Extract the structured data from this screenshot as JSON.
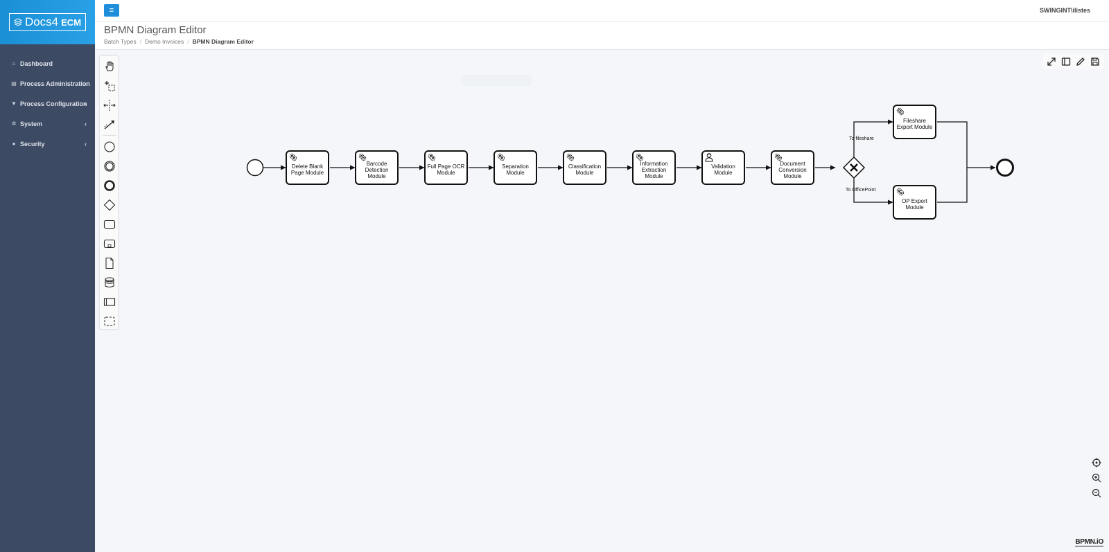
{
  "app": {
    "logo_main": "Docs4",
    "logo_suffix": "ECM"
  },
  "topbar": {
    "menu_icon": "hamburger-icon",
    "user": "SWINGINT\\ilistes"
  },
  "sidebar": {
    "items": [
      {
        "label": "Dashboard",
        "icon": "home-icon",
        "has_submenu": false
      },
      {
        "label": "Process Administration",
        "icon": "document-icon",
        "has_submenu": true
      },
      {
        "label": "Process Configuration",
        "icon": "filter-icon",
        "has_submenu": true
      },
      {
        "label": "System",
        "icon": "gear-icon",
        "has_submenu": true
      },
      {
        "label": "Security",
        "icon": "user-icon",
        "has_submenu": true
      }
    ]
  },
  "page": {
    "title": "BPMN Diagram Editor",
    "breadcrumb": [
      "Batch Types",
      "Demo Invoices",
      "BPMN Diagram Editor"
    ]
  },
  "palette": {
    "tools": [
      "hand-tool-icon",
      "lasso-tool-icon",
      "space-tool-icon",
      "global-connect-icon",
      "start-event-icon",
      "intermediate-event-icon",
      "end-event-icon",
      "gateway-icon",
      "task-icon",
      "subprocess-icon",
      "data-object-icon",
      "data-store-icon",
      "pool-icon",
      "group-icon"
    ]
  },
  "toolbar": {
    "buttons": [
      "fullscreen-icon",
      "properties-panel-icon",
      "edit-icon",
      "save-icon"
    ]
  },
  "zoom": {
    "buttons": [
      "reset-view-icon",
      "zoom-in-icon",
      "zoom-out-icon"
    ]
  },
  "diagram": {
    "tasks": [
      {
        "id": "t1",
        "label": "Delete Blank Page Module",
        "type": "service"
      },
      {
        "id": "t2",
        "label": "Barcode Detection Module",
        "type": "service"
      },
      {
        "id": "t3",
        "label": "Full Page OCR Module",
        "type": "service"
      },
      {
        "id": "t4",
        "label": "Separation Module",
        "type": "service"
      },
      {
        "id": "t5",
        "label": "Classification Module",
        "type": "service"
      },
      {
        "id": "t6",
        "label": "Information Extraction Module",
        "type": "service"
      },
      {
        "id": "t7",
        "label": "Validation Module",
        "type": "user"
      },
      {
        "id": "t8",
        "label": "Document Conversion Module",
        "type": "service"
      },
      {
        "id": "t9",
        "label": "Fileshare Export Module",
        "type": "service"
      },
      {
        "id": "t10",
        "label": "OP Export Module",
        "type": "service"
      }
    ],
    "edge_labels": {
      "to_fileshare": "To fileshare",
      "to_officepoint": "To OfficePoint"
    }
  },
  "watermark": "BPMN.iO"
}
